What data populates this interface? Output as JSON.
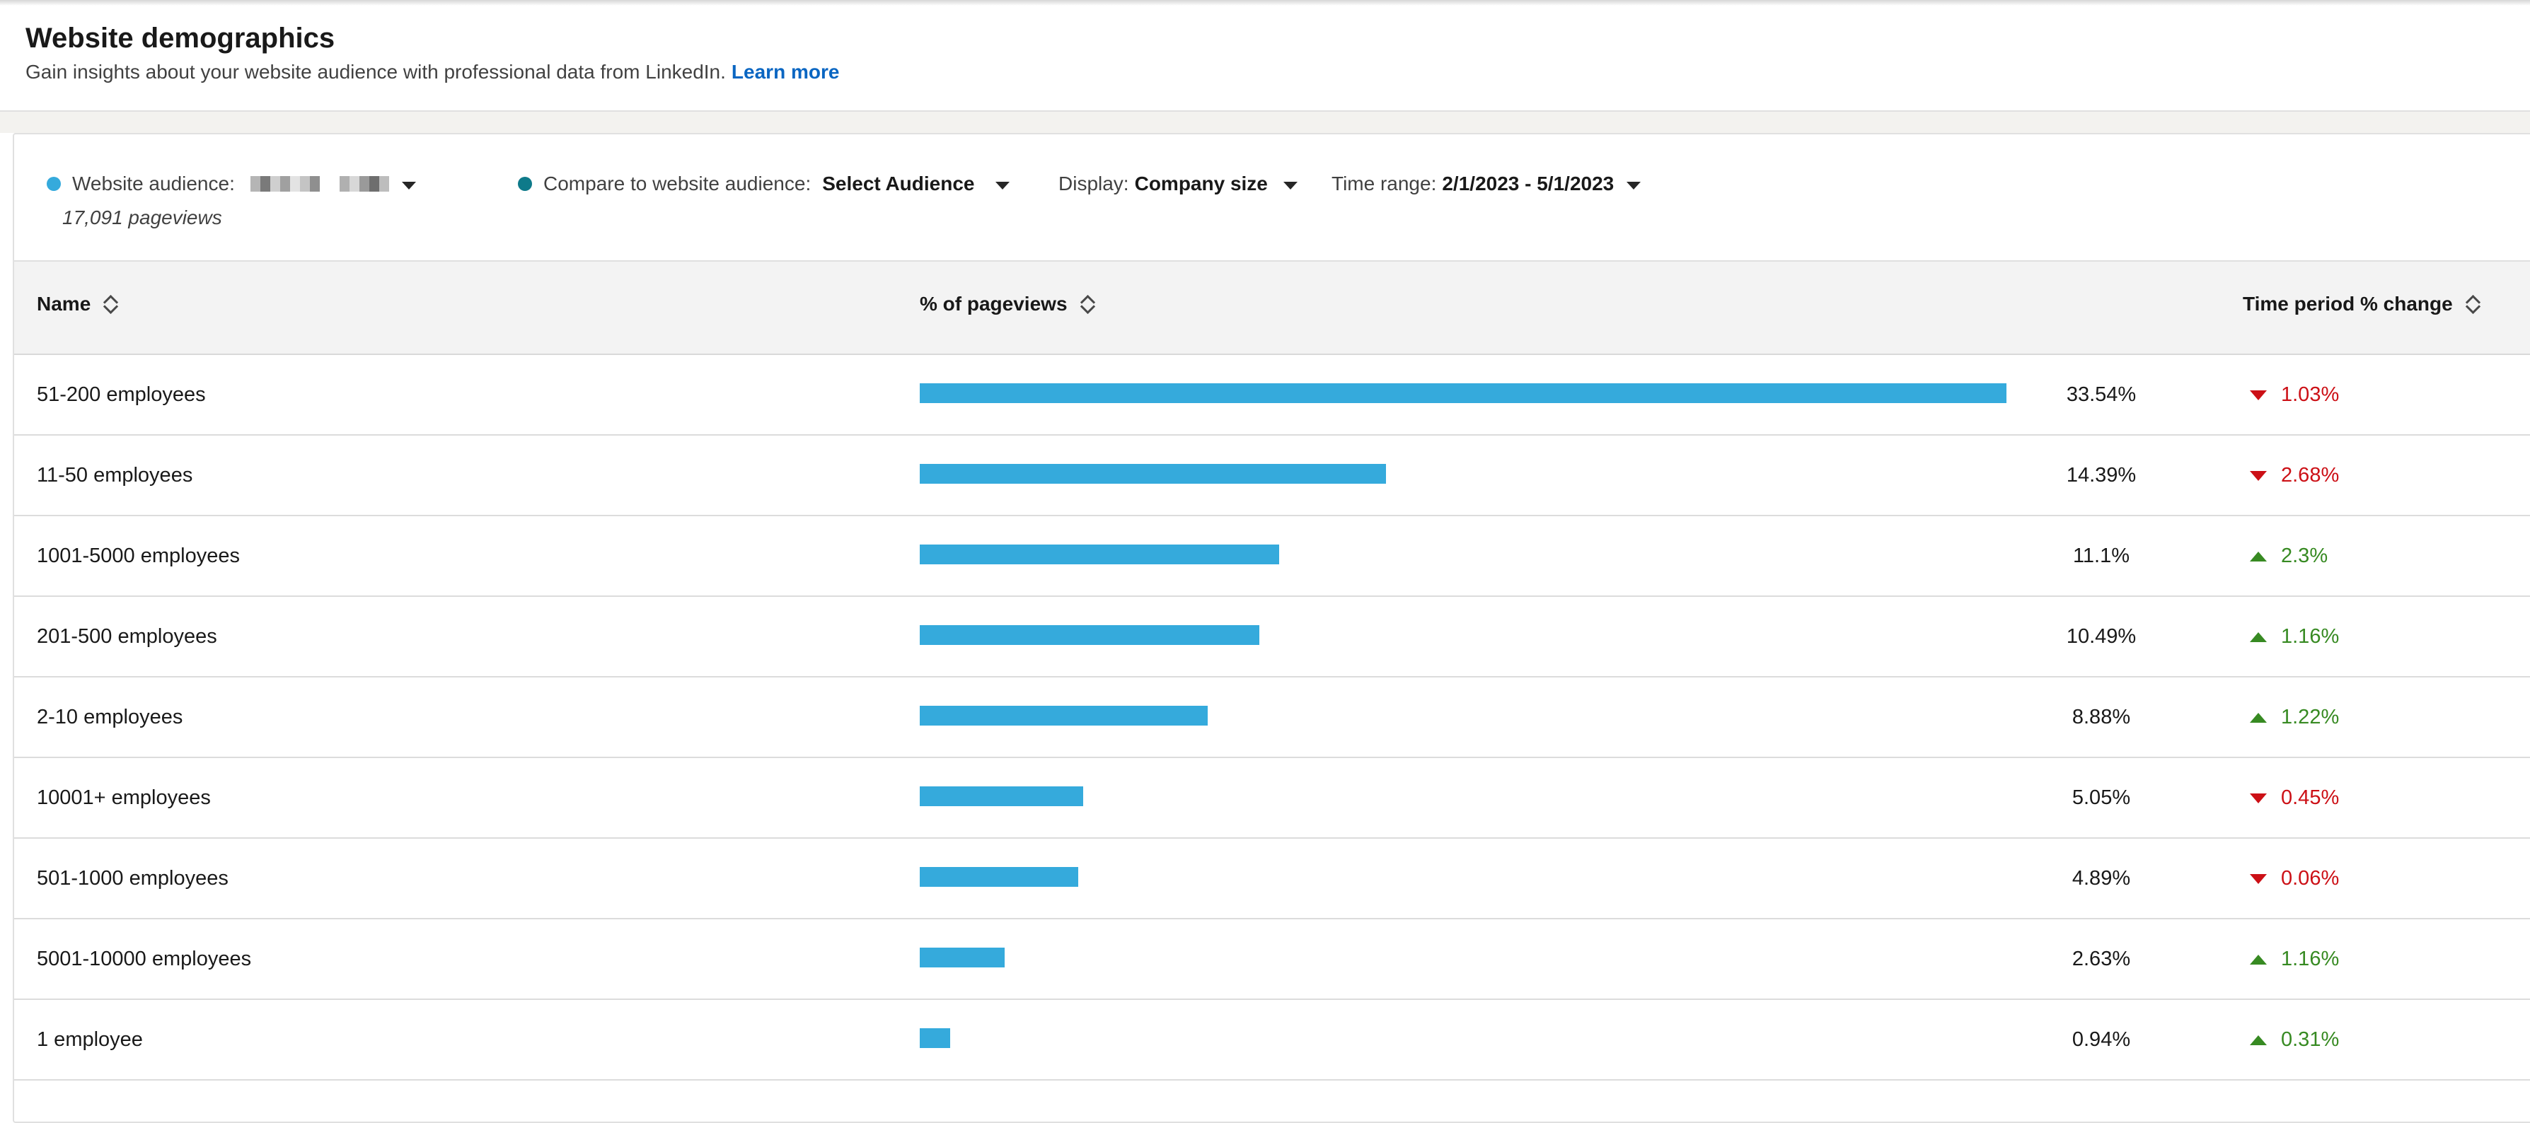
{
  "header": {
    "title": "Website demographics",
    "subtitle": "Gain insights about your website audience with professional data from LinkedIn.",
    "learn_more": "Learn more"
  },
  "filters": {
    "website_audience_label": "Website audience:",
    "pageviews": "17,091 pageviews",
    "compare_label": "Compare to website audience:",
    "compare_value": "Select Audience",
    "display_label": "Display:",
    "display_value": "Company size",
    "time_range_label": "Time range:",
    "time_range_value": "2/1/2023 - 5/1/2023",
    "audience_dot_color": "#35aadc",
    "compare_dot_color": "#0e7a8a"
  },
  "table": {
    "columns": [
      "Name",
      "% of pageviews",
      "Time period % change"
    ],
    "bar_color": "#35aadc",
    "max_pct": 33.54,
    "rows": [
      {
        "name": "51-200 employees",
        "pct": 33.54,
        "pct_label": "33.54%",
        "change": "1.03%",
        "direction": "down"
      },
      {
        "name": "11-50 employees",
        "pct": 14.39,
        "pct_label": "14.39%",
        "change": "2.68%",
        "direction": "down"
      },
      {
        "name": "1001-5000 employees",
        "pct": 11.1,
        "pct_label": "11.1%",
        "change": "2.3%",
        "direction": "up"
      },
      {
        "name": "201-500 employees",
        "pct": 10.49,
        "pct_label": "10.49%",
        "change": "1.16%",
        "direction": "up"
      },
      {
        "name": "2-10 employees",
        "pct": 8.88,
        "pct_label": "8.88%",
        "change": "1.22%",
        "direction": "up"
      },
      {
        "name": "10001+ employees",
        "pct": 5.05,
        "pct_label": "5.05%",
        "change": "0.45%",
        "direction": "down"
      },
      {
        "name": "501-1000 employees",
        "pct": 4.89,
        "pct_label": "4.89%",
        "change": "0.06%",
        "direction": "down"
      },
      {
        "name": "5001-10000 employees",
        "pct": 2.63,
        "pct_label": "2.63%",
        "change": "1.16%",
        "direction": "up"
      },
      {
        "name": "1 employee",
        "pct": 0.94,
        "pct_label": "0.94%",
        "change": "0.31%",
        "direction": "up"
      }
    ]
  }
}
